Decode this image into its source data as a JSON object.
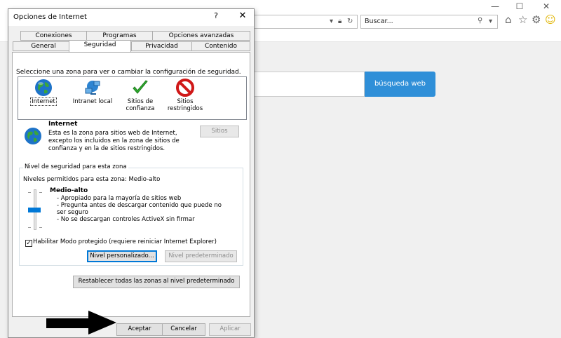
{
  "browser": {
    "window_controls": {
      "minimize": "—",
      "maximize": "☐",
      "close": "✕"
    },
    "search_placeholder": "Buscar...",
    "page_search_button": "búsqueda web"
  },
  "dialog": {
    "title": "Opciones de Internet",
    "help_label": "?",
    "close_label": "✕",
    "tabs_back": [
      "Conexiones",
      "Programas",
      "Opciones avanzadas"
    ],
    "tabs_front": [
      "General",
      "Seguridad",
      "Privacidad",
      "Contenido"
    ],
    "active_tab": "Seguridad",
    "zone_instruction": "Seleccione una zona para ver o cambiar la configuración de seguridad.",
    "zones": [
      {
        "label": "Internet",
        "icon": "globe-icon",
        "selected": true
      },
      {
        "label": "Intranet local",
        "icon": "network-icon"
      },
      {
        "label": "Sitios de confianza",
        "icon": "checkmark-icon"
      },
      {
        "label": "Sitios restringidos",
        "icon": "no-entry-icon"
      }
    ],
    "zone_desc": {
      "title": "Internet",
      "text": "Esta es la zona para sitios web de Internet, excepto los incluidos en la zona de sitios de confianza y en la de sitios restringidos."
    },
    "sites_button": "Sitios",
    "security": {
      "group_title": "Nivel de seguridad para esta zona",
      "allowed_levels": "Niveles permitidos para esta zona: Medio-alto",
      "level_name": "Medio-alto",
      "level_lines": [
        "- Apropiado para la mayoría de sitios web",
        "- Pregunta antes de descargar contenido que puede no ser seguro",
        "- No se descargan controles ActiveX sin firmar"
      ],
      "protected_mode_label": "Habilitar Modo protegido (requiere reiniciar Internet Explorer)",
      "protected_mode_checked": true,
      "custom_level_button": "Nivel personalizado...",
      "default_level_button": "Nivel predeterminado"
    },
    "reset_zones_button": "Restablecer todas las zonas al nivel predeterminado",
    "footer": {
      "ok": "Aceptar",
      "cancel": "Cancelar",
      "apply": "Aplicar"
    }
  },
  "colors": {
    "accent": "#0078d7",
    "search_button": "#2f8fd8"
  }
}
